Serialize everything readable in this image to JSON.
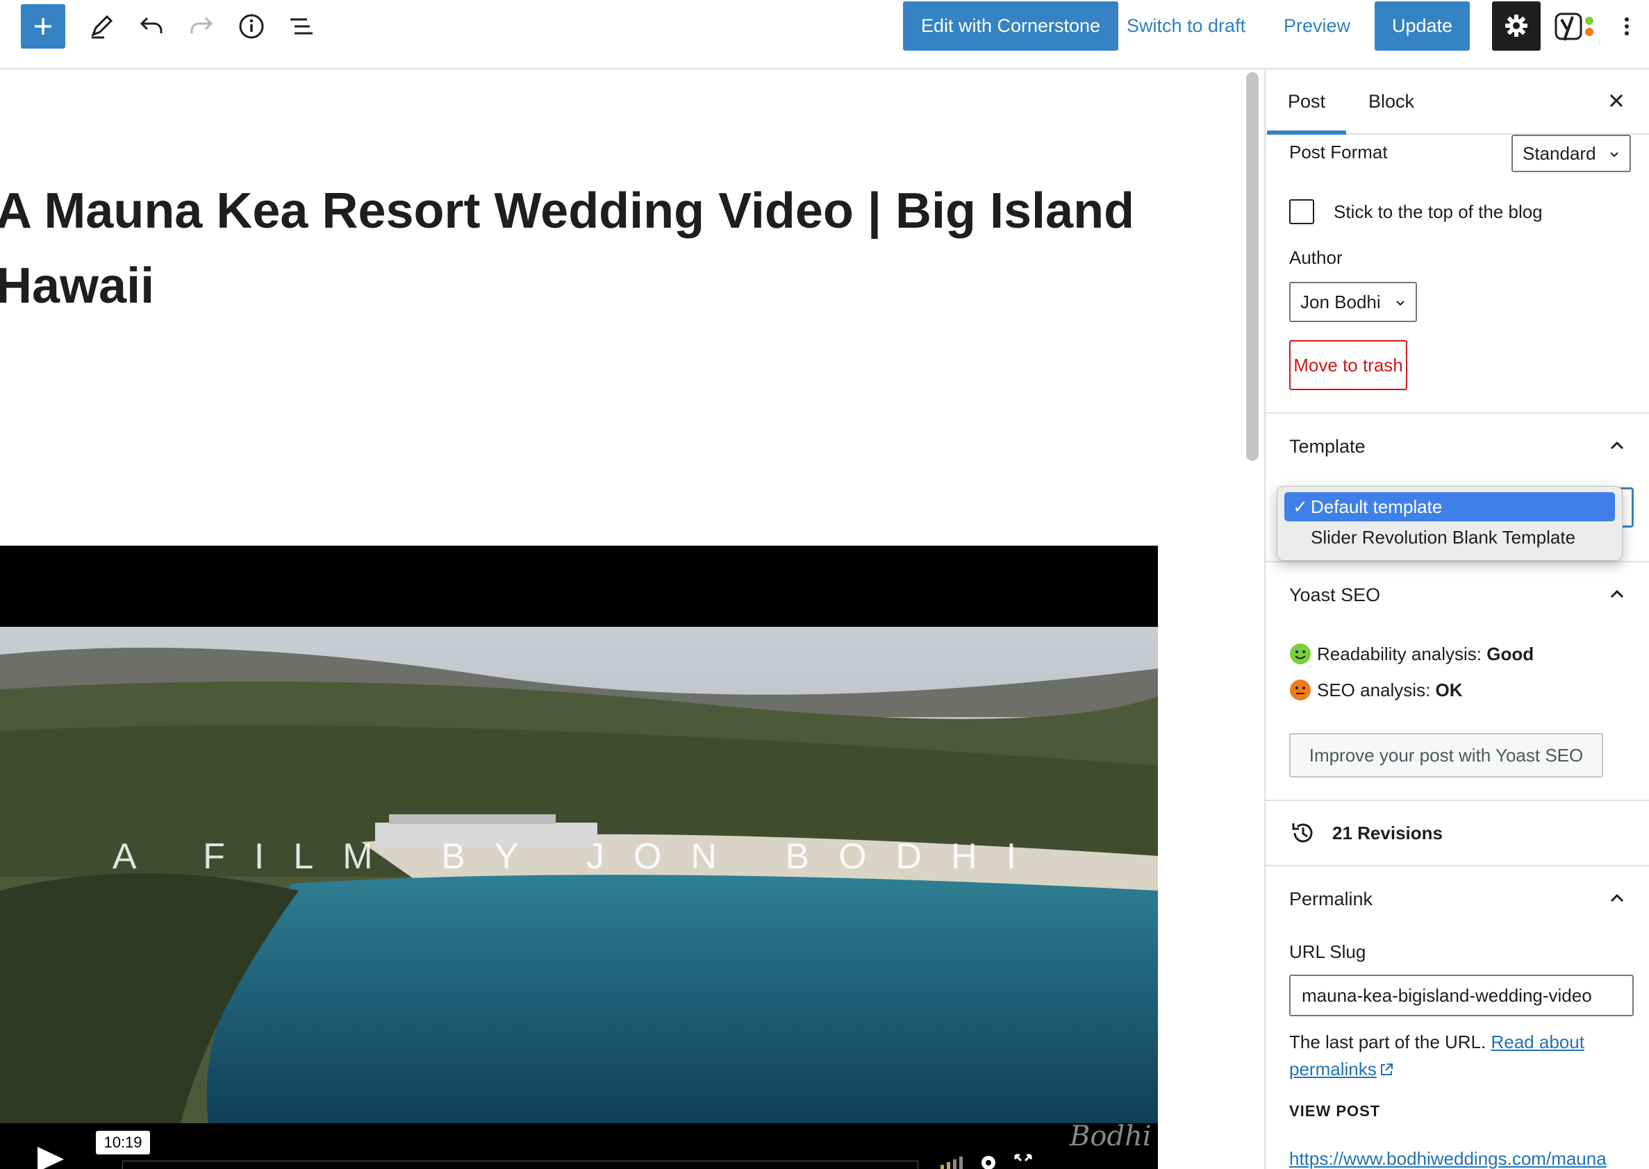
{
  "toolbar": {
    "cornerstone_label": "Edit with Cornerstone",
    "switch_draft_label": "Switch to draft",
    "preview_label": "Preview",
    "update_label": "Update",
    "icons": [
      "plus-icon",
      "pencil-icon",
      "undo-icon",
      "redo-icon",
      "info-icon",
      "list-view-icon",
      "gear-icon",
      "yoast-icon",
      "more-options-icon"
    ]
  },
  "editor": {
    "post_title": "A Mauna Kea Resort Wedding Video | Big Island Hawaii",
    "video": {
      "caption": "A FILM BY JON BODHI",
      "timestamp": "10:19",
      "logo_text": "Bodhi"
    }
  },
  "sidebar": {
    "tabs": [
      {
        "label": "Post",
        "active": true
      },
      {
        "label": "Block",
        "active": false
      }
    ],
    "post_format": {
      "label": "Post Format",
      "value": "Standard"
    },
    "sticky": {
      "label": "Stick to the top of the blog",
      "checked": false
    },
    "author": {
      "label": "Author",
      "value": "Jon Bodhi"
    },
    "trash_label": "Move to trash",
    "template": {
      "title": "Template",
      "options": [
        {
          "label": "Default template",
          "selected": true
        },
        {
          "label": "Slider Revolution Blank Template",
          "selected": false
        }
      ]
    },
    "yoast": {
      "title": "Yoast SEO",
      "readability_label": "Readability analysis:",
      "readability_value": "Good",
      "seo_label": "SEO analysis:",
      "seo_value": "OK",
      "improve_label": "Improve your post with Yoast SEO"
    },
    "revisions_label": "21 Revisions",
    "permalink": {
      "title": "Permalink",
      "slug_label": "URL Slug",
      "slug_value": "mauna-kea-bigisland-wedding-video",
      "help_text": "The last part of the URL.",
      "help_link": "Read about permalinks",
      "view_post_label": "VIEW POST",
      "view_post_url": "https://www.bodhiweddings.com/mauna"
    }
  },
  "colors": {
    "accent": "#3582c4",
    "danger": "#cc1818",
    "good": "#7ad03a",
    "ok": "#ee7c1b",
    "dropdown_highlight": "#3f7fe8"
  }
}
